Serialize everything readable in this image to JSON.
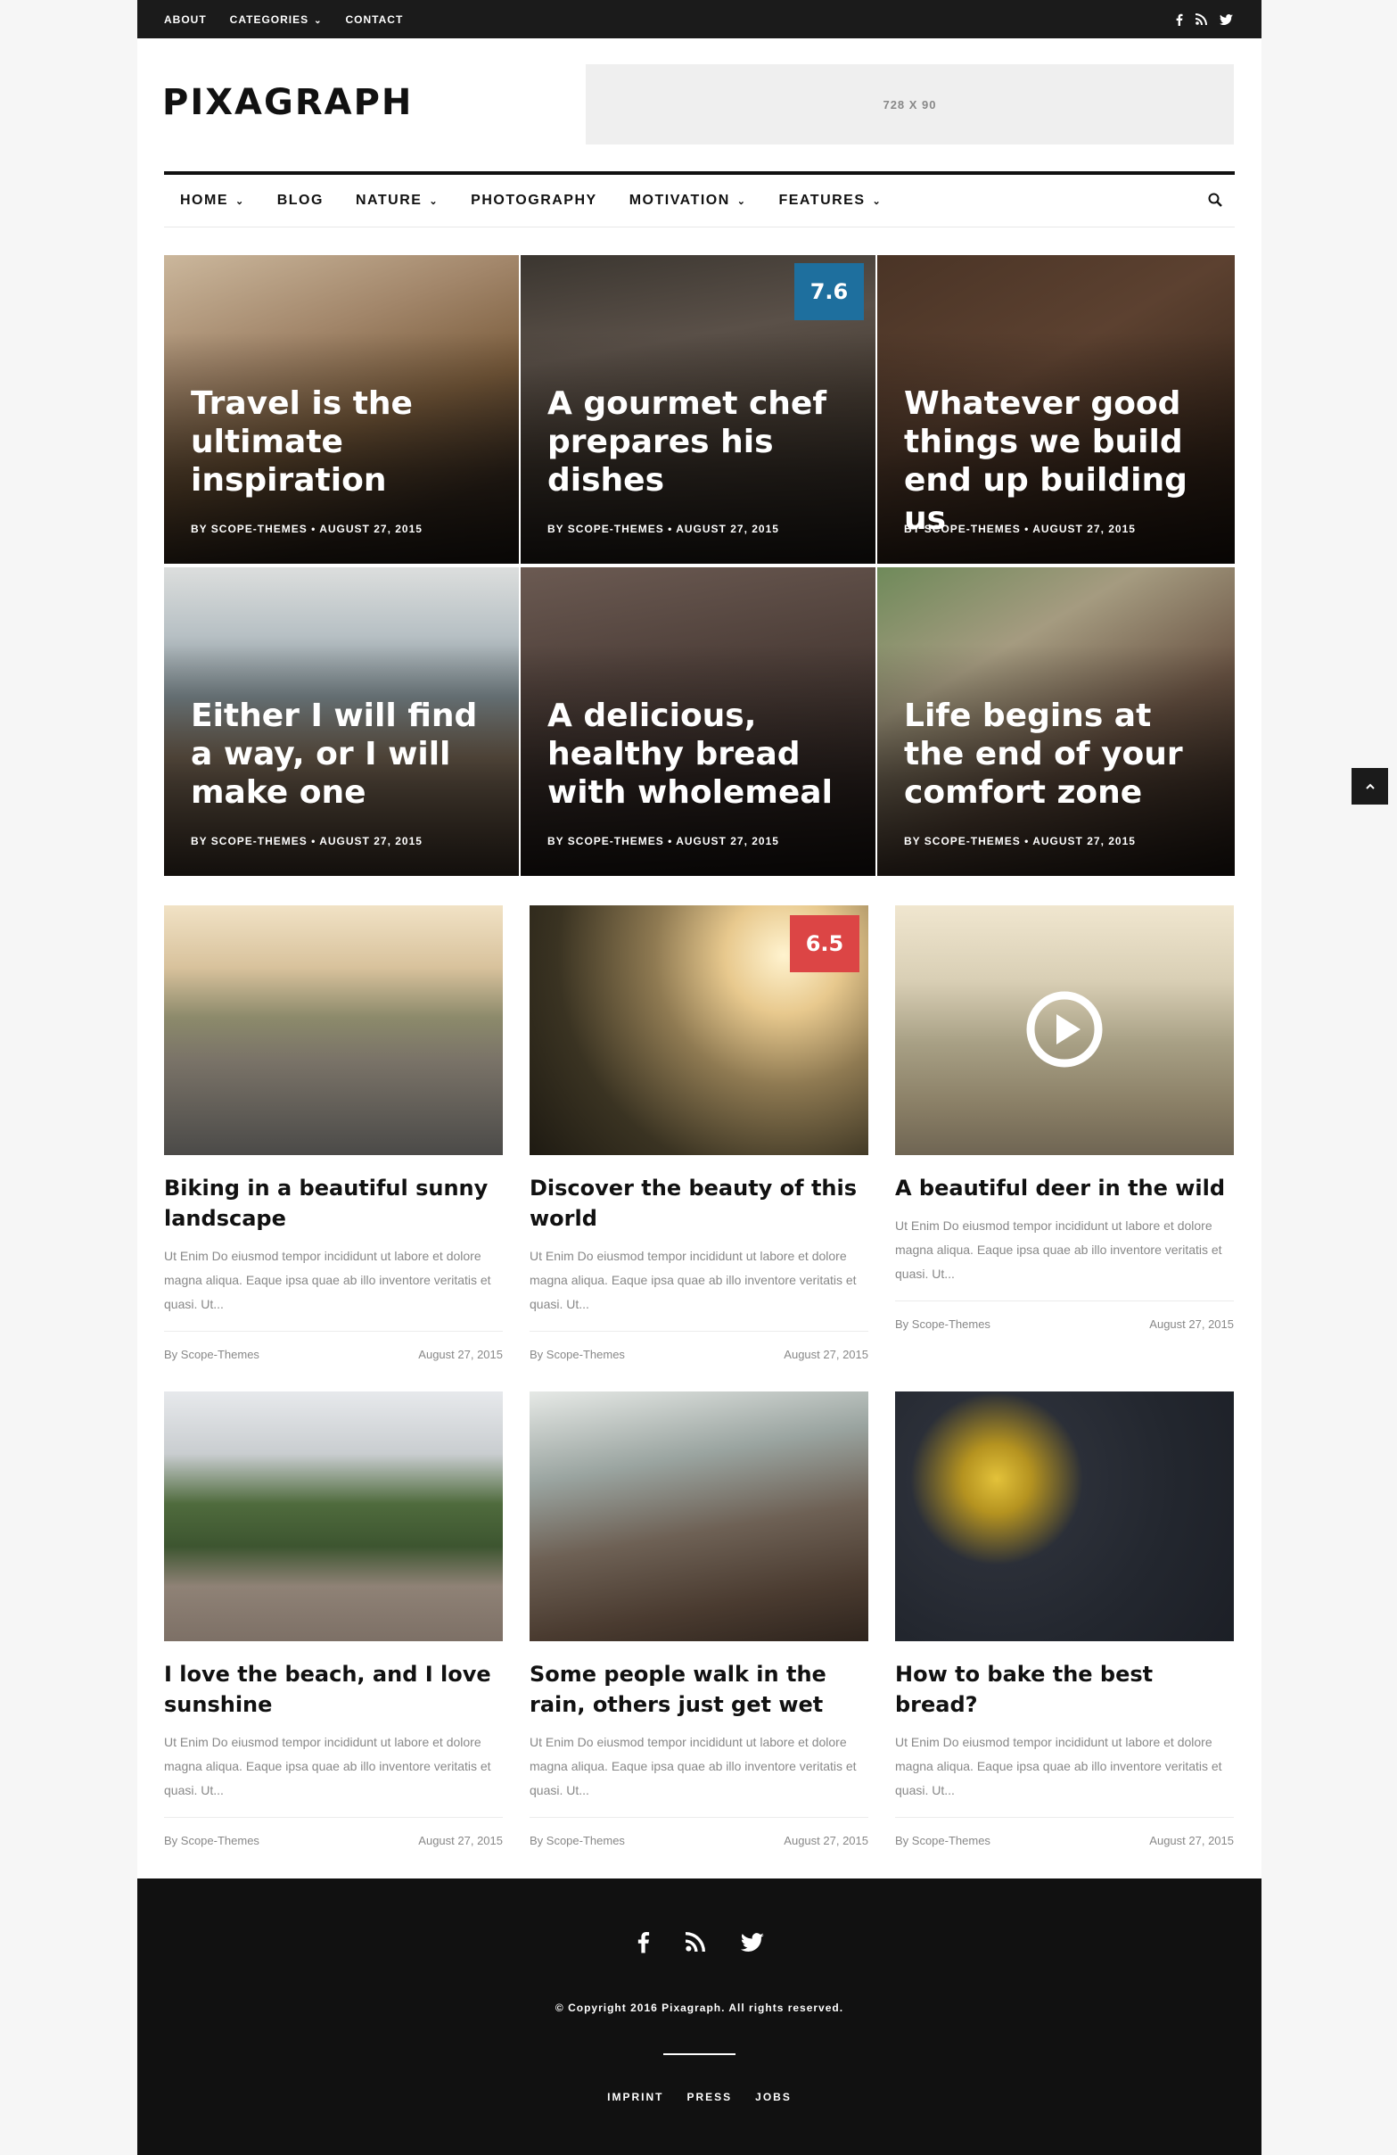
{
  "topbar": {
    "links": [
      {
        "label": "ABOUT",
        "has_dropdown": false
      },
      {
        "label": "CATEGORIES",
        "has_dropdown": true
      },
      {
        "label": "CONTACT",
        "has_dropdown": false
      }
    ],
    "social_icons": [
      "facebook-icon",
      "rss-icon",
      "twitter-icon"
    ]
  },
  "header": {
    "logo": "PIXAGRAPH",
    "ad_label": "728 X 90"
  },
  "mainnav": {
    "items": [
      {
        "label": "HOME",
        "has_dropdown": true
      },
      {
        "label": "BLOG",
        "has_dropdown": false
      },
      {
        "label": "NATURE",
        "has_dropdown": true
      },
      {
        "label": "PHOTOGRAPHY",
        "has_dropdown": false
      },
      {
        "label": "MOTIVATION",
        "has_dropdown": true
      },
      {
        "label": "FEATURES",
        "has_dropdown": true
      }
    ],
    "search_icon": "search-icon"
  },
  "featured": [
    {
      "title": "Travel is the ultimate inspiration",
      "meta": "BY SCOPE-THEMES  •  AUGUST 27, 2015",
      "score": ""
    },
    {
      "title": "A gourmet chef prepares his dishes",
      "meta": "BY SCOPE-THEMES  •  AUGUST 27, 2015",
      "score": "7.6"
    },
    {
      "title": "Whatever good things we build end up building us",
      "meta": "BY SCOPE-THEMES  •  AUGUST 27, 2015",
      "score": ""
    },
    {
      "title": "Either I will find a way, or I will make one",
      "meta": "BY SCOPE-THEMES  •  AUGUST 27, 2015",
      "score": ""
    },
    {
      "title": "A delicious, healthy bread with wholemeal",
      "meta": "BY SCOPE-THEMES  •  AUGUST 27, 2015",
      "score": ""
    },
    {
      "title": "Life begins at the end of your comfort zone",
      "meta": "BY SCOPE-THEMES  •  AUGUST 27, 2015",
      "score": ""
    }
  ],
  "posts": [
    {
      "title": "Biking in a beautiful sunny landscape",
      "excerpt": "Ut Enim Do eiusmod tempor incididunt ut labore et dolore magna aliqua. Eaque ipsa quae ab illo inventore veritatis et quasi. Ut...",
      "author": "By Scope-Themes",
      "date": "August 27, 2015",
      "score": ""
    },
    {
      "title": "Discover the beauty of this world",
      "excerpt": "Ut Enim Do eiusmod tempor incididunt ut labore et dolore magna aliqua. Eaque ipsa quae ab illo inventore veritatis et quasi. Ut...",
      "author": "By Scope-Themes",
      "date": "August 27, 2015",
      "score": "6.5"
    },
    {
      "title": "A beautiful deer in the wild",
      "excerpt": "Ut Enim Do eiusmod tempor incididunt ut labore et dolore magna aliqua. Eaque ipsa quae ab illo inventore veritatis et quasi. Ut...",
      "author": "By Scope-Themes",
      "date": "August 27, 2015",
      "score": ""
    },
    {
      "title": "I love the beach, and I love sunshine",
      "excerpt": "Ut Enim Do eiusmod tempor incididunt ut labore et dolore magna aliqua. Eaque ipsa quae ab illo inventore veritatis et quasi. Ut...",
      "author": "By Scope-Themes",
      "date": "August 27, 2015",
      "score": ""
    },
    {
      "title": "Some people walk in the rain, others just get wet",
      "excerpt": "Ut Enim Do eiusmod tempor incididunt ut labore et dolore magna aliqua. Eaque ipsa quae ab illo inventore veritatis et quasi. Ut...",
      "author": "By Scope-Themes",
      "date": "August 27, 2015",
      "score": ""
    },
    {
      "title": "How to bake the best bread?",
      "excerpt": "Ut Enim Do eiusmod tempor incididunt ut labore et dolore magna aliqua. Eaque ipsa quae ab illo inventore veritatis et quasi. Ut...",
      "author": "By Scope-Themes",
      "date": "August 27, 2015",
      "score": ""
    }
  ],
  "footer": {
    "social_icons": [
      "facebook-icon",
      "rss-icon",
      "twitter-icon"
    ],
    "copyright": "© Copyright 2016 Pixagraph. All rights reserved.",
    "links": [
      "IMPRINT",
      "PRESS",
      "JOBS"
    ]
  },
  "colors": {
    "dark": "#1b1b1b",
    "score_blue": "#1e6f9e",
    "score_red": "#dc4545",
    "footer_bg": "#111111"
  }
}
